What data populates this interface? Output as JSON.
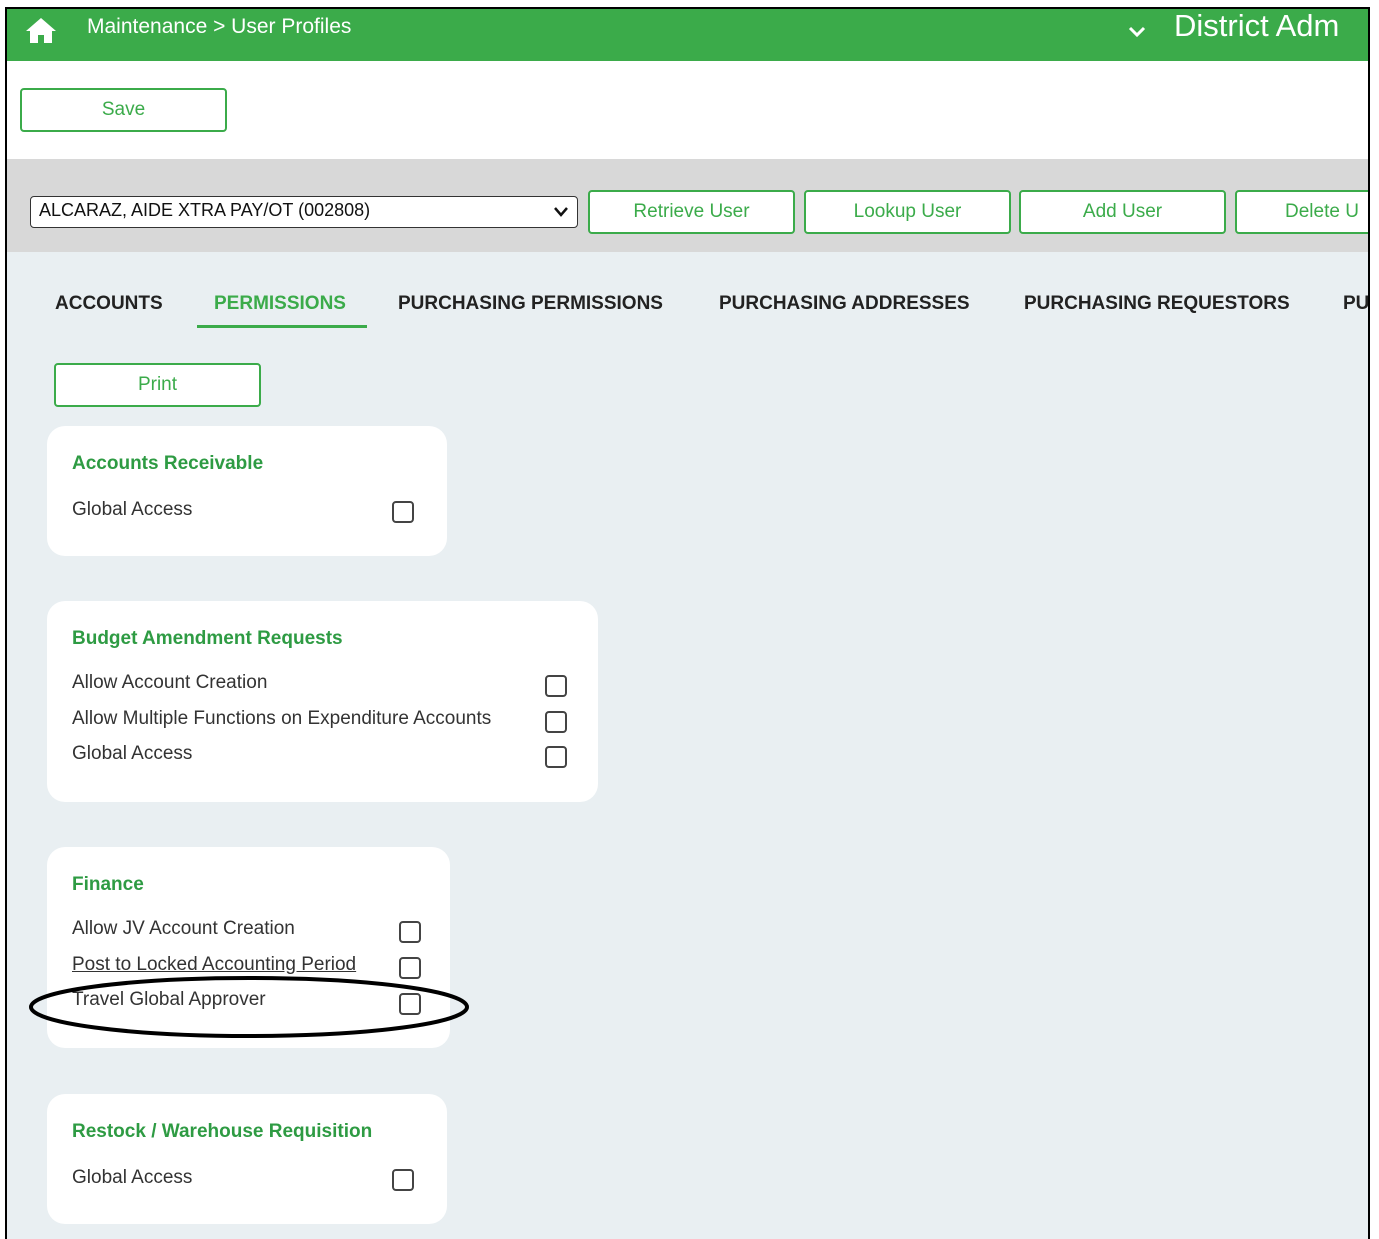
{
  "header": {
    "home_icon": "home-icon",
    "breadcrumb": "Maintenance > User Profiles",
    "dropdown_icon": "chevron-down-icon",
    "district_label": "District Adm",
    "bar_color": "#3bab4a"
  },
  "toolbar": {
    "save_label": "Save"
  },
  "user_bar": {
    "selected_user": "ALCARAZ, AIDE XTRA PAY/OT (002808)",
    "buttons": [
      "Retrieve User",
      "Lookup User",
      "Add User",
      "Delete U"
    ]
  },
  "tabs": [
    {
      "label": "ACCOUNTS",
      "active": false
    },
    {
      "label": "PERMISSIONS",
      "active": true
    },
    {
      "label": "PURCHASING PERMISSIONS",
      "active": false
    },
    {
      "label": "PURCHASING ADDRESSES",
      "active": false
    },
    {
      "label": "PURCHASING REQUESTORS",
      "active": false
    },
    {
      "label": "PU",
      "active": false
    }
  ],
  "print_label": "Print",
  "sections": [
    {
      "title": "Accounts Receivable",
      "items": [
        {
          "label": "Global Access",
          "checked": false
        }
      ]
    },
    {
      "title": "Budget Amendment Requests",
      "items": [
        {
          "label": "Allow Account Creation",
          "checked": false
        },
        {
          "label": "Allow Multiple Functions on Expenditure Accounts",
          "checked": false
        },
        {
          "label": "Global Access",
          "checked": false
        }
      ]
    },
    {
      "title": "Finance",
      "items": [
        {
          "label": "Allow JV Account Creation",
          "checked": false
        },
        {
          "label": "Post to Locked Accounting Period",
          "checked": false
        },
        {
          "label": "Travel Global Approver",
          "checked": false
        }
      ]
    },
    {
      "title": "Restock / Warehouse Requisition",
      "items": [
        {
          "label": "Global Access",
          "checked": false
        }
      ]
    }
  ],
  "accent_color": "#3bab4a"
}
